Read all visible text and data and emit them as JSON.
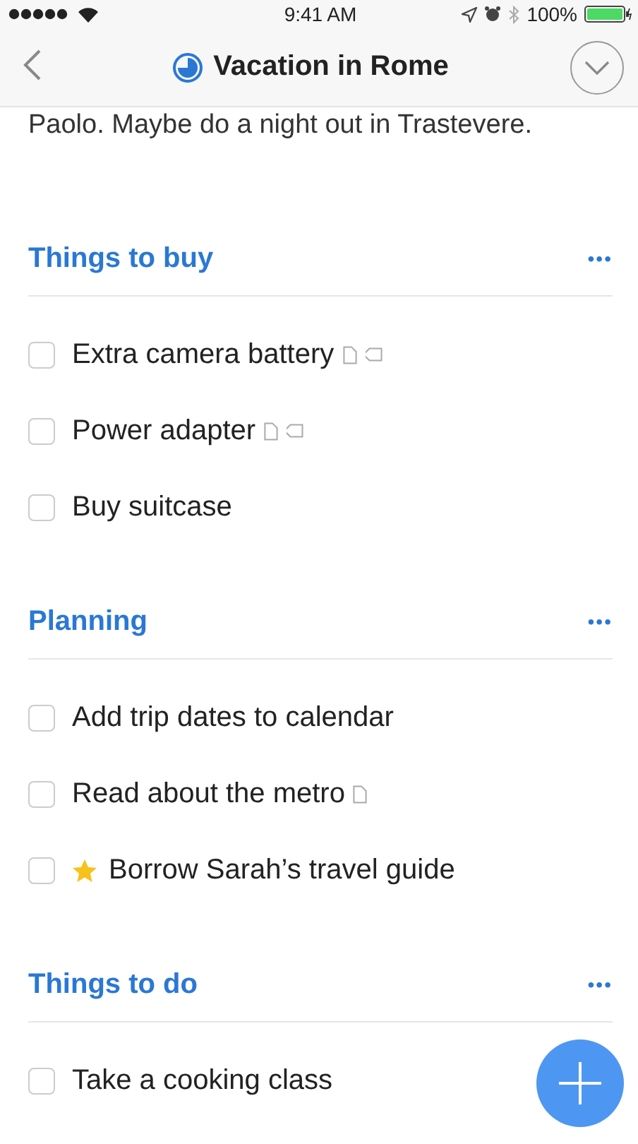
{
  "status_bar": {
    "time": "9:41 AM",
    "battery": "100%"
  },
  "nav": {
    "title": "Vacation in Rome"
  },
  "notes": "Paolo. Maybe do a night out in Trastevere.",
  "sections": [
    {
      "title": "Things to buy",
      "more": "•••",
      "items": [
        {
          "text": "Extra camera battery",
          "checked": false,
          "starred": false,
          "has_note": true,
          "has_tag": true
        },
        {
          "text": "Power adapter",
          "checked": false,
          "starred": false,
          "has_note": true,
          "has_tag": true
        },
        {
          "text": "Buy suitcase",
          "checked": false,
          "starred": false,
          "has_note": false,
          "has_tag": false
        }
      ]
    },
    {
      "title": "Planning",
      "more": "•••",
      "items": [
        {
          "text": "Add trip dates to calendar",
          "checked": false,
          "starred": false,
          "has_note": false,
          "has_tag": false
        },
        {
          "text": "Read about the metro",
          "checked": false,
          "starred": false,
          "has_note": true,
          "has_tag": false
        },
        {
          "text": "Borrow Sarah’s travel guide",
          "checked": false,
          "starred": true,
          "has_note": false,
          "has_tag": false
        }
      ]
    },
    {
      "title": "Things to do",
      "more": "•••",
      "items": [
        {
          "text": "Take a cooking class",
          "checked": false,
          "starred": false,
          "has_note": false,
          "has_tag": false
        }
      ]
    }
  ]
}
